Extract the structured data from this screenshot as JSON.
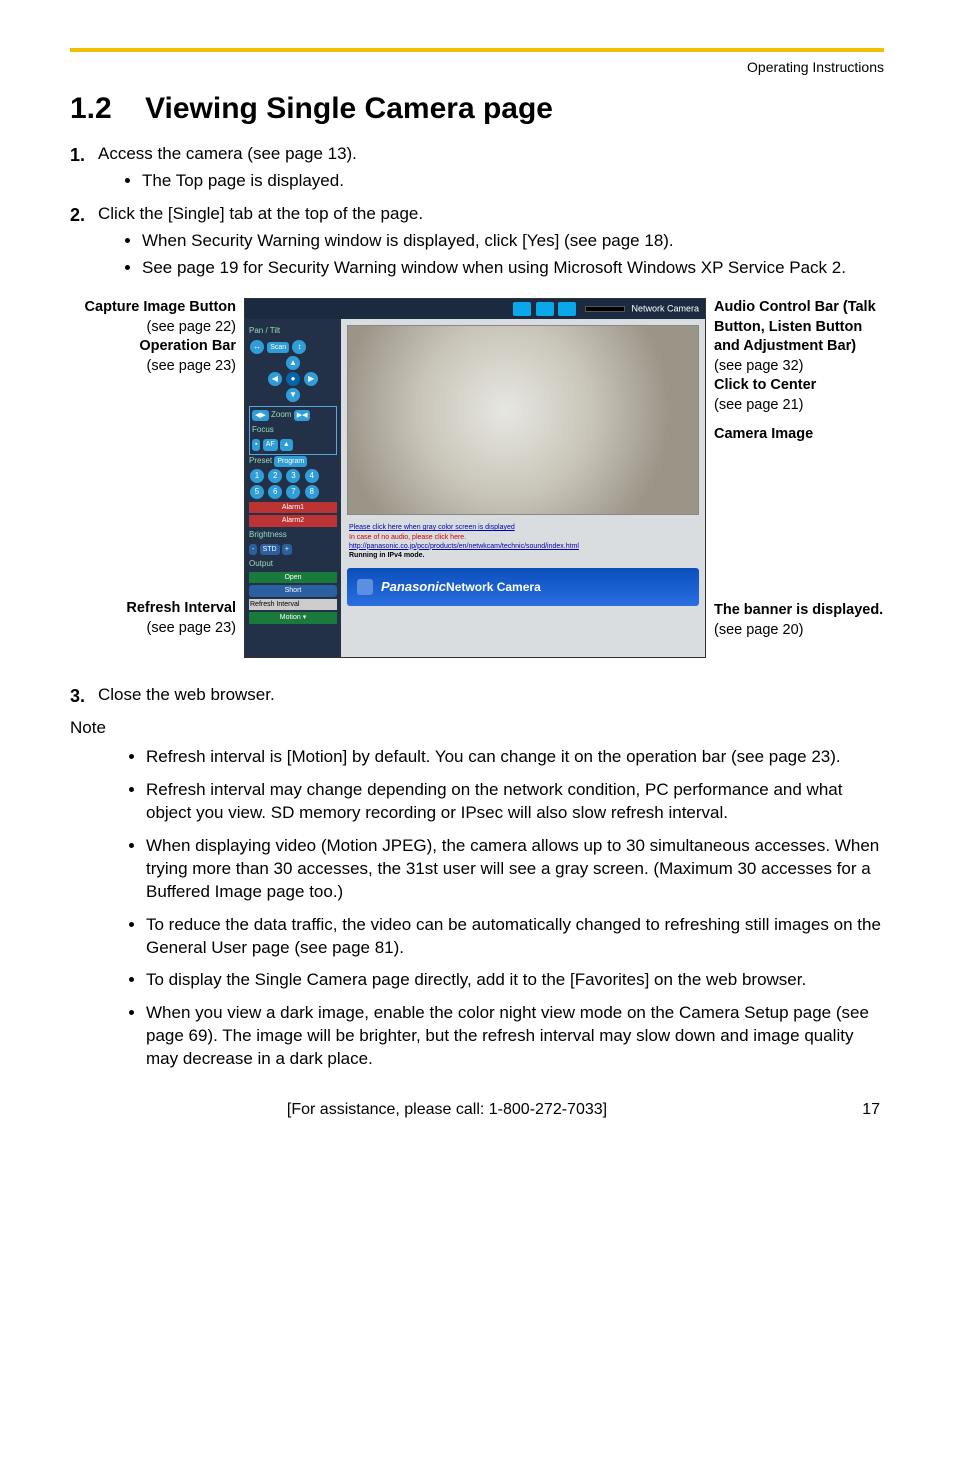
{
  "header": {
    "doc_title": "Operating Instructions"
  },
  "section": {
    "number": "1.2",
    "title": "Viewing Single Camera page"
  },
  "steps": [
    {
      "num": "1.",
      "text": "Access the camera (see page 13).",
      "sub": [
        "The Top page is displayed."
      ]
    },
    {
      "num": "2.",
      "text": "Click the [Single] tab at the top of the page.",
      "sub": [
        "When Security Warning window is displayed, click [Yes] (see page 18).",
        "See page 19 for Security Warning window when using Microsoft Windows XP Service Pack 2."
      ]
    }
  ],
  "figure": {
    "left": {
      "capture_bold": "Capture Image Button",
      "capture_ref": "(see page 22)",
      "op_bold": "Operation Bar",
      "op_ref": "(see page 23)",
      "refresh_bold": "Refresh Interval",
      "refresh_ref": "(see page 23)"
    },
    "right": {
      "audio_bold": "Audio Control Bar (Talk Button, Listen Button and Adjustment Bar)",
      "audio_ref": "(see page 32)",
      "click_bold": "Click to Center",
      "click_ref": "(see page 21)",
      "camimg_bold": "Camera Image",
      "banner_bold": "The banner is displayed.",
      "banner_ref": "(see page 20)"
    },
    "mock": {
      "top_label": "Network Camera",
      "pan_tilt": "Pan / Tilt",
      "scan": "Scan",
      "zoom": "Zoom",
      "focus": "Focus",
      "af": "AF",
      "preset": "Preset",
      "program": "Program",
      "presets": [
        "1",
        "2",
        "3",
        "4",
        "5",
        "6",
        "7",
        "8"
      ],
      "alarm1": "Alarm1",
      "alarm2": "Alarm2",
      "brightness": "Brightness",
      "std": "STD",
      "minus": "-",
      "plus": "+",
      "output": "Output",
      "open": "Open",
      "short": "Short",
      "refresh_label": "Refresh Interval",
      "refresh_value": "Motion",
      "link1": "Please click here when gray color screen is displayed",
      "link2_pre": "In case of no audio, please click here.",
      "link3": "http://panasonic.co.jp/pcc/products/en/netwkcam/technic/sound/index.html",
      "running": "Running in IPv4 mode.",
      "banner_brand": "Panasonic",
      "banner_text": " Network Camera"
    }
  },
  "step3": {
    "num": "3.",
    "text": "Close the web browser."
  },
  "note_label": "Note",
  "notes": [
    "Refresh interval is [Motion] by default. You can change it on the operation bar (see page 23).",
    "Refresh interval may change depending on the network condition, PC performance and what object you view. SD memory recording or IPsec will also slow refresh interval.",
    "When displaying video (Motion JPEG), the camera allows up to 30 simultaneous accesses. When trying more than 30 accesses, the 31st user will see a gray screen. (Maximum 30 accesses for a Buffered Image page too.)",
    "To reduce the data traffic, the video can be automatically changed to refreshing still images on the General User page (see page 81).",
    "To display the Single Camera page directly, add it to the [Favorites] on the web browser.",
    "When you view a dark image, enable the color night view mode on the Camera Setup page (see page 69). The image will be brighter, but the refresh interval may slow down and image quality may decrease in a dark place."
  ],
  "footer": {
    "assist": "[For assistance, please call: 1-800-272-7033]",
    "page": "17"
  }
}
